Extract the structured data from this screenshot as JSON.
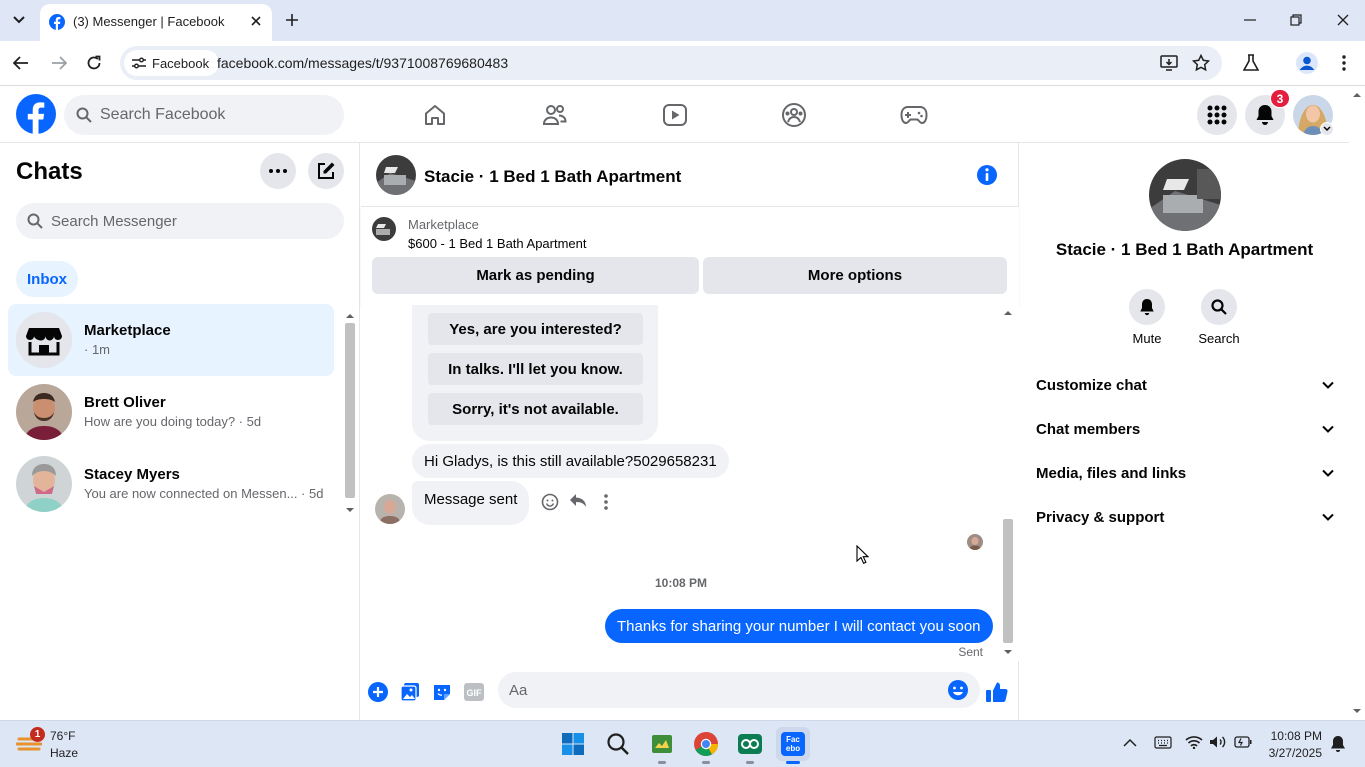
{
  "browser": {
    "tab_title": "(3) Messenger | Facebook",
    "site_chip": "Facebook",
    "url": "facebook.com/messages/t/9371008769680483"
  },
  "fb": {
    "search_placeholder": "Search Facebook",
    "notifications_count": "3",
    "brand_color": "#0866ff"
  },
  "chats": {
    "title": "Chats",
    "search_placeholder": "Search Messenger",
    "filter": "Inbox",
    "items": [
      {
        "name": "Marketplace",
        "preview": "· 1m"
      },
      {
        "name": "Brett Oliver",
        "preview": "How are you doing today? · 5d"
      },
      {
        "name": "Stacey Myers",
        "preview": "You are now connected on Messen... · 5d"
      }
    ]
  },
  "conversation": {
    "title": "Stacie · 1 Bed 1 Bath Apartment",
    "marketplace_label": "Marketplace",
    "listing": "$600 - 1 Bed 1 Bath Apartment",
    "mark_pending": "Mark as pending",
    "more_options": "More options",
    "quick_replies": [
      "Yes, are you interested?",
      "In talks. I'll let you know.",
      "Sorry, it's not available."
    ],
    "msg_in_1": "Hi Gladys, is this still available?5029658231",
    "msg_in_2": "Message sent",
    "timestamp": "10:08 PM",
    "msg_out": "Thanks for sharing your number I will contact you soon",
    "status": "Sent",
    "composer_placeholder": "Aa"
  },
  "info": {
    "name": "Stacie · 1 Bed 1 Bath Apartment",
    "mute": "Mute",
    "search": "Search",
    "sections": [
      "Customize chat",
      "Chat members",
      "Media, files and links",
      "Privacy & support"
    ]
  },
  "taskbar": {
    "weather_badge": "1",
    "temp": "76°F",
    "condition": "Haze",
    "time": "10:08 PM",
    "date": "3/27/2025",
    "facebook_app_label": "Fac ebo"
  }
}
